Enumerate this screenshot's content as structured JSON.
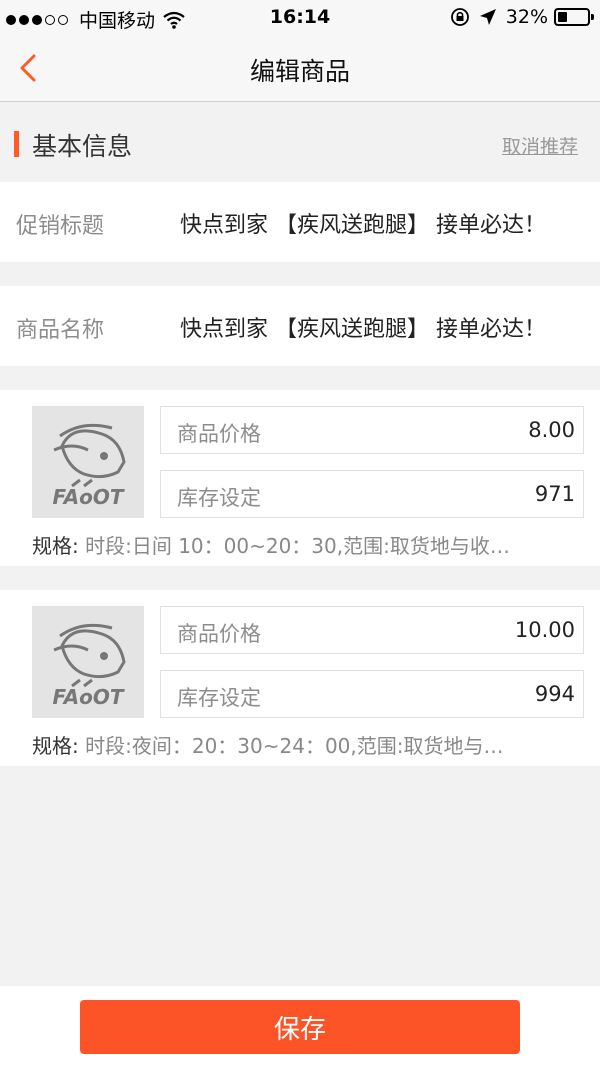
{
  "status_bar": {
    "carrier": "中国移动",
    "time": "16:14",
    "battery": "32%",
    "battery_level": 0.32,
    "signal_bars": 3,
    "signal_total": 5
  },
  "nav": {
    "back_icon": "chevron-left-icon",
    "title": "编辑商品"
  },
  "section": {
    "title": "基本信息",
    "cancel_label": "取消推荐"
  },
  "info_rows": [
    {
      "label": "促销标题",
      "value": "快点到家 【疾风送跑腿】 接单必达！"
    },
    {
      "label": "商品名称",
      "value": "快点到家 【疾风送跑腿】 接单必达！"
    }
  ],
  "products": [
    {
      "thumb_text": "FAoOT",
      "price_label": "商品价格",
      "price_value": "8.00",
      "stock_label": "库存设定",
      "stock_value": "971",
      "spec_label": "规格:",
      "spec_value": "时段:日间  10：00~20：30,范围:取货地与收…"
    },
    {
      "thumb_text": "FAoOT",
      "price_label": "商品价格",
      "price_value": "10.00",
      "stock_label": "库存设定",
      "stock_value": "994",
      "spec_label": "规格:",
      "spec_value": "时段:夜间：20：30~24：00,范围:取货地与…"
    }
  ],
  "bottom": {
    "save_label": "保存"
  },
  "colors": {
    "accent": "#fd5427",
    "background": "#f2f2f2"
  }
}
